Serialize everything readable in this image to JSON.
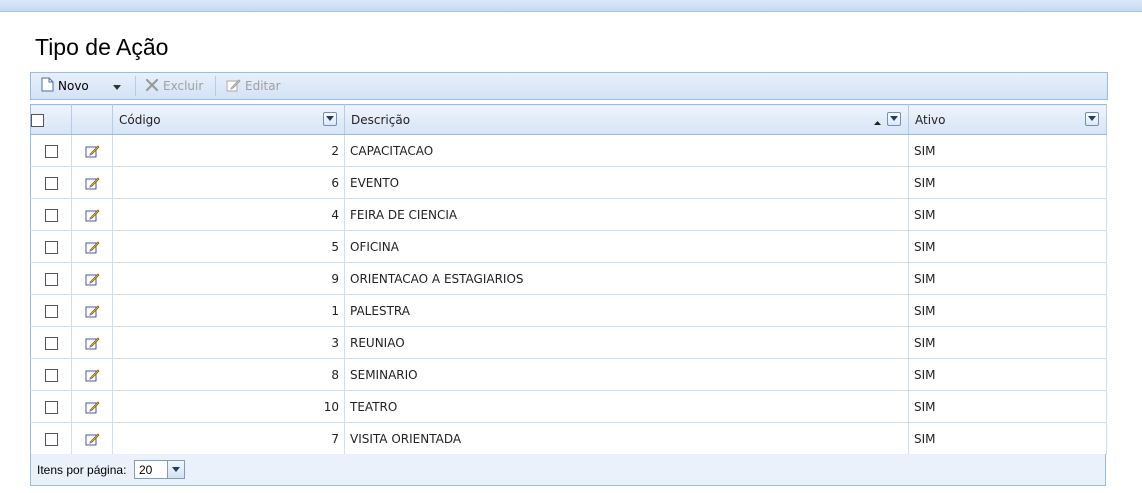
{
  "page": {
    "title": "Tipo de Ação"
  },
  "toolbar": {
    "new_label": "Novo",
    "delete_label": "Excluir",
    "edit_label": "Editar"
  },
  "grid": {
    "columns": [
      "Código",
      "Descrição",
      "Ativo"
    ],
    "sort": {
      "column": "Descrição",
      "direction": "ascending"
    },
    "rows": [
      {
        "codigo": "2",
        "descricao": "CAPACITACAO",
        "ativo": "SIM"
      },
      {
        "codigo": "6",
        "descricao": "EVENTO",
        "ativo": "SIM"
      },
      {
        "codigo": "4",
        "descricao": "FEIRA DE CIENCIA",
        "ativo": "SIM"
      },
      {
        "codigo": "5",
        "descricao": "OFICINA",
        "ativo": "SIM"
      },
      {
        "codigo": "9",
        "descricao": "ORIENTACAO A ESTAGIARIOS",
        "ativo": "SIM"
      },
      {
        "codigo": "1",
        "descricao": "PALESTRA",
        "ativo": "SIM"
      },
      {
        "codigo": "3",
        "descricao": "REUNIAO",
        "ativo": "SIM"
      },
      {
        "codigo": "8",
        "descricao": "SEMINARIO",
        "ativo": "SIM"
      },
      {
        "codigo": "10",
        "descricao": "TEATRO",
        "ativo": "SIM"
      },
      {
        "codigo": "7",
        "descricao": "VISITA ORIENTADA",
        "ativo": "SIM"
      }
    ]
  },
  "footer": {
    "items_per_page_label": "Itens por página:",
    "items_per_page_value": "20"
  },
  "icons": {
    "new": "new-document-icon",
    "dropdown": "chevron-down-icon",
    "delete": "close-icon",
    "edit": "pencil-icon",
    "row_edit": "edit-record-icon",
    "filter": "filter-dropdown-icon",
    "sort": "sort-ascending-icon"
  },
  "colors": {
    "border": "#99bbe8",
    "header_bg": "#d6e4f6",
    "disabled_text": "#a0a0a0"
  }
}
